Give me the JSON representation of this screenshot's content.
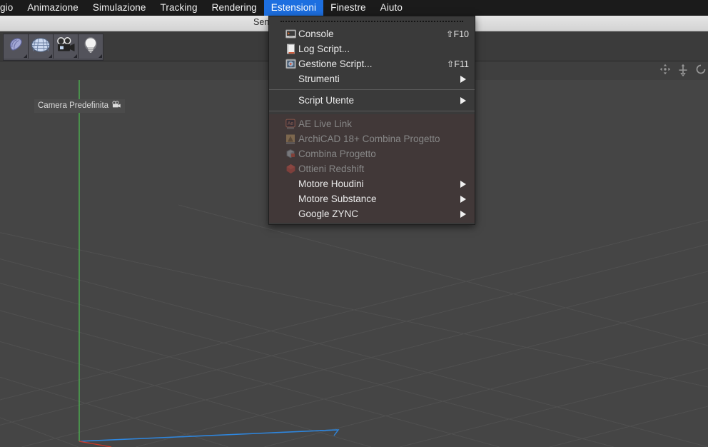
{
  "menubar": {
    "items": [
      {
        "label": "gio",
        "active": false
      },
      {
        "label": "Animazione",
        "active": false
      },
      {
        "label": "Simulazione",
        "active": false
      },
      {
        "label": "Tracking",
        "active": false
      },
      {
        "label": "Rendering",
        "active": false
      },
      {
        "label": "Estensioni",
        "active": true
      },
      {
        "label": "Finestre",
        "active": false
      },
      {
        "label": "Aiuto",
        "active": false
      }
    ],
    "active_accent": "#1d6fe0"
  },
  "titlebar": {
    "text": "Sen"
  },
  "toolbar": {
    "buttons": [
      {
        "name": "undo-tool",
        "icon": "blob-icon"
      },
      {
        "name": "grid-tool",
        "icon": "grid-plane-icon"
      },
      {
        "name": "camera-tool",
        "icon": "movie-camera-icon"
      },
      {
        "name": "light-tool",
        "icon": "light-bulb-icon"
      }
    ]
  },
  "viewport": {
    "camera_label": "Camera Predefinita",
    "camera_icon": "movie-camera-icon",
    "background_color": "#454545",
    "grid_color": "#4f4f4f",
    "axis_y_color": "#4caf50",
    "axis_z_color": "#2e86de",
    "axis_x_color": "#c0392b",
    "header_icons": [
      {
        "name": "move-view-icon"
      },
      {
        "name": "scale-view-icon"
      },
      {
        "name": "rotate-view-icon"
      }
    ]
  },
  "dropdown": {
    "title": "Estensioni",
    "groups": [
      {
        "name": "scripting",
        "warm": false,
        "items": [
          {
            "label": "Console",
            "icon": "console-icon",
            "shortcut": "⇧F10",
            "arrow": false,
            "disabled": false
          },
          {
            "label": "Log Script...",
            "icon": "log-script-icon",
            "shortcut": "",
            "arrow": false,
            "disabled": false
          },
          {
            "label": "Gestione Script...",
            "icon": "script-manager-icon",
            "shortcut": "⇧F11",
            "arrow": false,
            "disabled": false
          },
          {
            "label": "Strumenti",
            "icon": "",
            "shortcut": "",
            "arrow": true,
            "disabled": false
          }
        ]
      },
      {
        "name": "user-scripts",
        "warm": false,
        "items": [
          {
            "label": "Script Utente",
            "icon": "",
            "shortcut": "",
            "arrow": true,
            "disabled": false
          }
        ]
      },
      {
        "name": "plugins",
        "warm": true,
        "items": [
          {
            "label": "AE Live Link",
            "icon": "after-effects-icon",
            "shortcut": "",
            "arrow": false,
            "disabled": true
          },
          {
            "label": "ArchiCAD 18+ Combina Progetto",
            "icon": "archicad-icon",
            "shortcut": "",
            "arrow": false,
            "disabled": true
          },
          {
            "label": "Combina Progetto",
            "icon": "merge-project-icon",
            "shortcut": "",
            "arrow": false,
            "disabled": true
          },
          {
            "label": "Ottieni Redshift",
            "icon": "redshift-icon",
            "shortcut": "",
            "arrow": false,
            "disabled": true
          },
          {
            "label": "Motore Houdini",
            "icon": "",
            "shortcut": "",
            "arrow": true,
            "disabled": false
          },
          {
            "label": "Motore Substance",
            "icon": "",
            "shortcut": "",
            "arrow": true,
            "disabled": false
          },
          {
            "label": "Google ZYNC",
            "icon": "",
            "shortcut": "",
            "arrow": true,
            "disabled": false
          }
        ]
      }
    ]
  }
}
